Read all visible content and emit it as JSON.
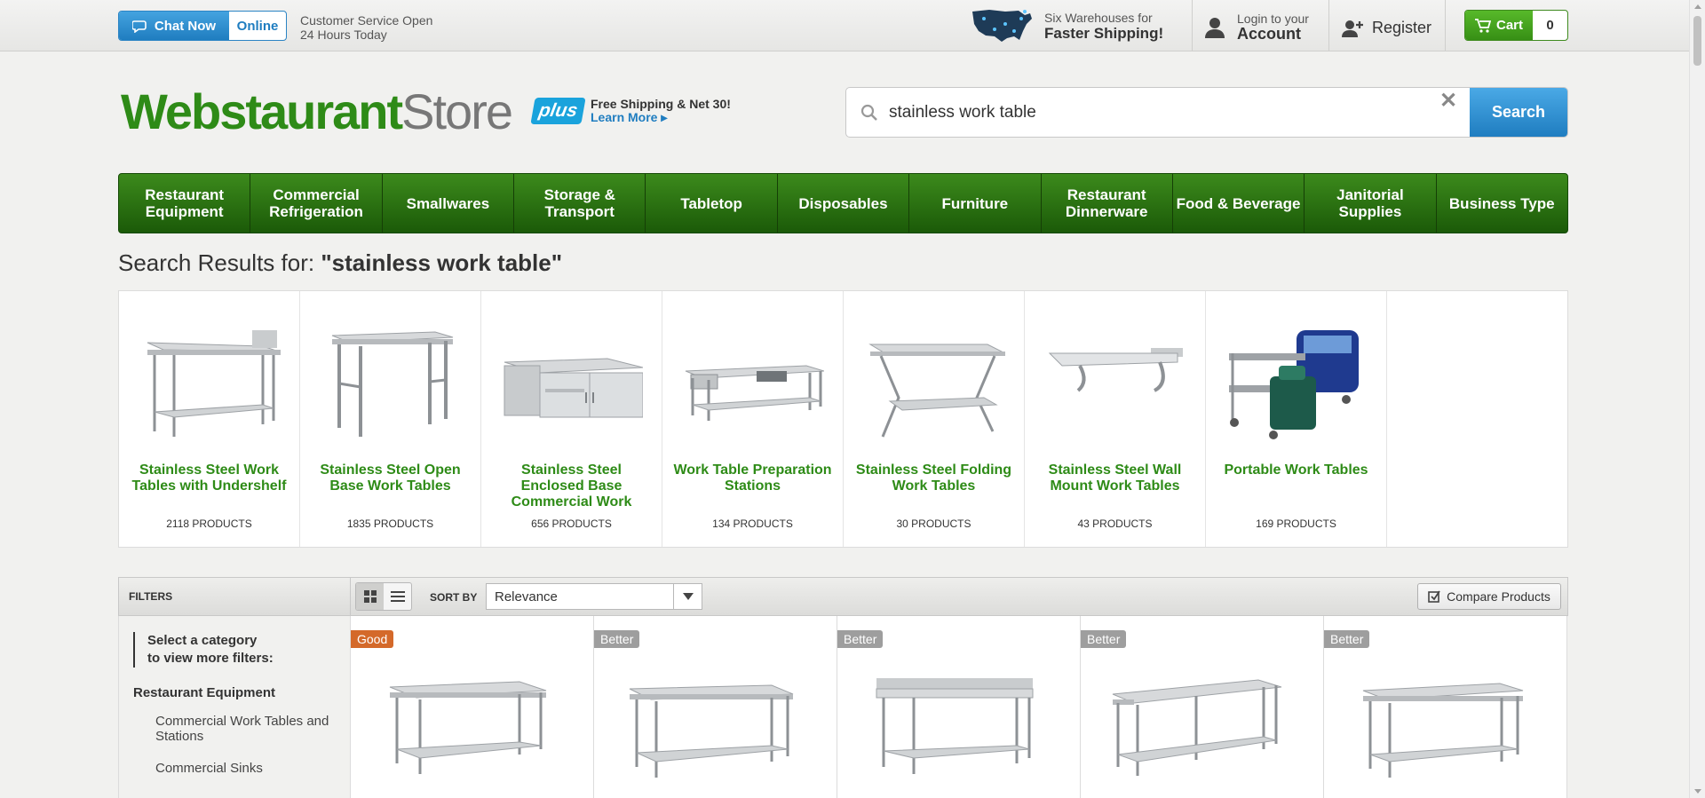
{
  "topbar": {
    "chat_label": "Chat Now",
    "online_label": "Online",
    "cs_line1": "Customer Service Open",
    "cs_line2": "24 Hours Today",
    "ship_line1": "Six Warehouses for",
    "ship_line2": "Faster Shipping!",
    "login_line1": "Login to your",
    "login_line2": "Account",
    "register_label": "Register",
    "cart_label": "Cart",
    "cart_count": "0"
  },
  "header": {
    "logo_bold": "Webstaurant",
    "logo_light": "Store",
    "plus_badge": "plus",
    "plus_line1": "Free Shipping & Net 30!",
    "plus_line2": "Learn More",
    "search_value": "stainless work table",
    "search_button": "Search"
  },
  "nav": {
    "items": [
      "Restaurant Equipment",
      "Commercial Refrigeration",
      "Smallwares",
      "Storage & Transport",
      "Tabletop",
      "Disposables",
      "Furniture",
      "Restaurant Dinnerware",
      "Food & Beverage",
      "Janitorial Supplies",
      "Business Type"
    ]
  },
  "results": {
    "prefix": "Search Results for: ",
    "query": "\"stainless work table\""
  },
  "categories": [
    {
      "name": "Stainless Steel Work Tables with Undershelf",
      "count": "2118 PRODUCTS"
    },
    {
      "name": "Stainless Steel Open Base Work Tables",
      "count": "1835 PRODUCTS"
    },
    {
      "name": "Stainless Steel Enclosed Base Commercial Work Tables",
      "count": "656 PRODUCTS"
    },
    {
      "name": "Work Table Preparation Stations",
      "count": "134 PRODUCTS"
    },
    {
      "name": "Stainless Steel Folding Work Tables",
      "count": "30 PRODUCTS"
    },
    {
      "name": "Stainless Steel Wall Mount Work Tables",
      "count": "43 PRODUCTS"
    },
    {
      "name": "Portable Work Tables",
      "count": "169 PRODUCTS"
    }
  ],
  "filters": {
    "label": "FILTERS",
    "sort_label": "SORT BY",
    "sort_value": "Relevance",
    "compare_label": "Compare Products",
    "hint_line1": "Select a category",
    "hint_line2": "to view more filters:",
    "category_head": "Restaurant Equipment",
    "sub1": "Commercial Work Tables and Stations",
    "sub2": "Commercial Sinks"
  },
  "products": [
    {
      "tag": "Good"
    },
    {
      "tag": "Better"
    },
    {
      "tag": "Better"
    },
    {
      "tag": "Better"
    },
    {
      "tag": "Better"
    }
  ],
  "colors": {
    "brand_green": "#2e8b17",
    "nav_green": "#1b5a08",
    "link_blue": "#1f7dc0",
    "good_tag": "#d4692a",
    "better_tag": "#9e9e9e"
  }
}
